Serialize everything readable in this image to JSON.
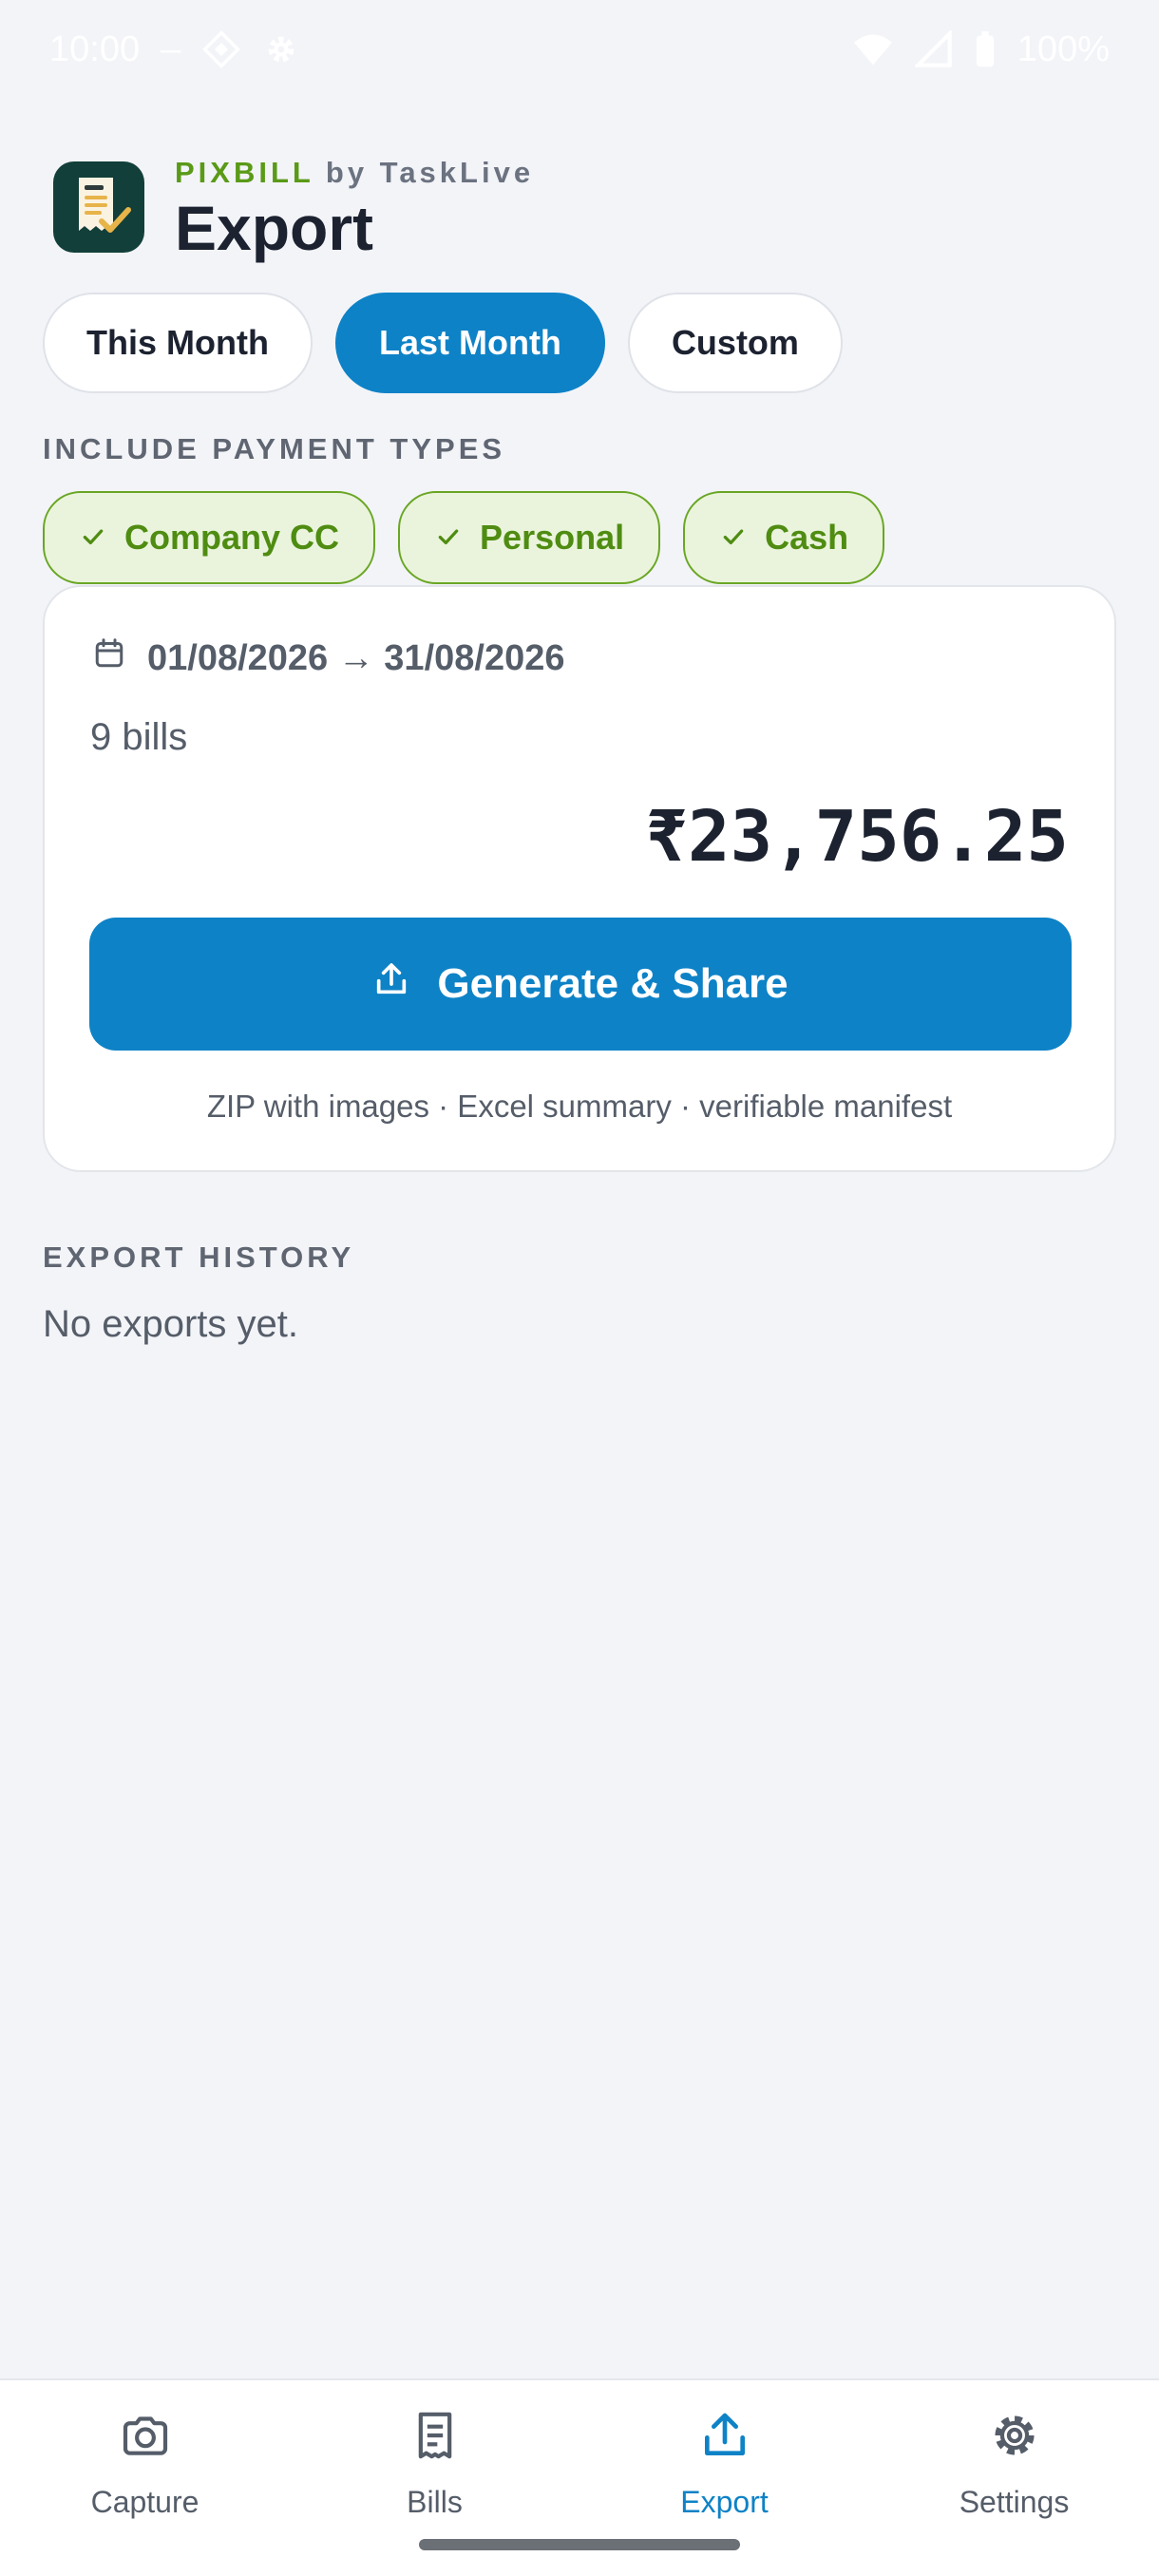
{
  "status_bar": {
    "time": "10:00",
    "dash": "–",
    "battery": "100%"
  },
  "header": {
    "brand": "PIXBILL",
    "by_line": " by TaskLive",
    "title": "Export"
  },
  "date_ranges": [
    {
      "label": "This Month",
      "selected": false
    },
    {
      "label": "Last Month",
      "selected": true
    },
    {
      "label": "Custom",
      "selected": false
    }
  ],
  "payment_types": {
    "heading": "INCLUDE PAYMENT TYPES",
    "items": [
      {
        "label": "Company CC",
        "checked": true
      },
      {
        "label": "Personal",
        "checked": true
      },
      {
        "label": "Cash",
        "checked": true
      }
    ]
  },
  "summary": {
    "range": "01/08/2026 → 31/08/2026",
    "bill_count": "9 bills",
    "total": "₹23,756.25",
    "generate_label": "Generate & Share",
    "note": "ZIP with images · Excel summary · verifiable manifest"
  },
  "history": {
    "heading": "EXPORT HISTORY",
    "empty_text": "No exports yet."
  },
  "bottom_nav": [
    {
      "label": "Capture",
      "icon": "camera-icon",
      "active": false
    },
    {
      "label": "Bills",
      "icon": "receipt-icon",
      "active": false
    },
    {
      "label": "Export",
      "icon": "upload-icon",
      "active": true
    },
    {
      "label": "Settings",
      "icon": "gear-icon",
      "active": false
    }
  ],
  "colors": {
    "accent": "#0e82c6",
    "brand_green": "#5a9a17",
    "chip_green_bg": "#eaf4dc",
    "background": "#f3f4f8"
  }
}
